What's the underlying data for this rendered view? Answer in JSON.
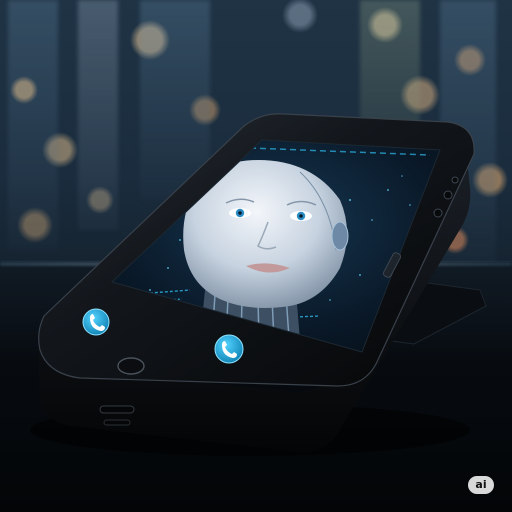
{
  "image": {
    "subject": "smartphone",
    "screen_face": "humanoid-android-face",
    "watermark_text": "ai"
  },
  "colors": {
    "screen_accent": "#2fb8e8",
    "call_button": "#1fa6d6",
    "body": "#0c0e11"
  },
  "icons": {
    "left_button": "phone-icon",
    "right_button": "phone-icon"
  }
}
